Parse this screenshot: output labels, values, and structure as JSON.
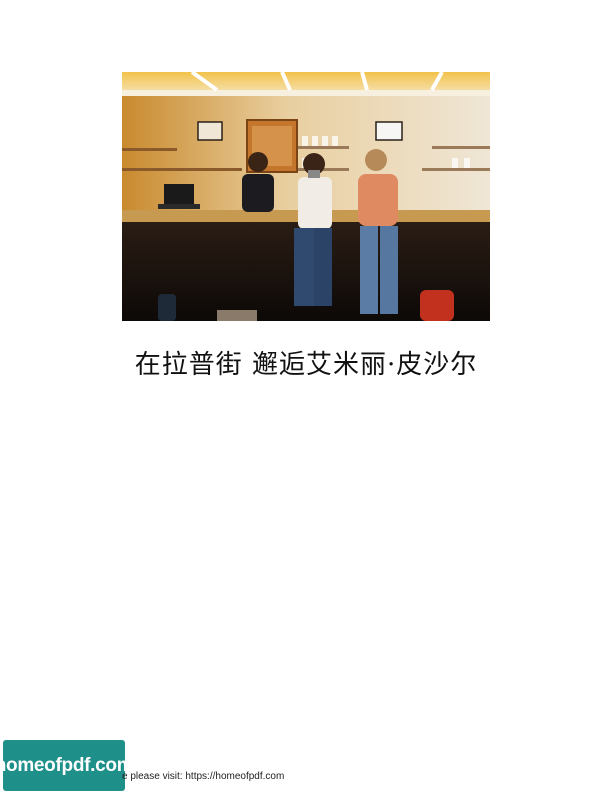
{
  "document": {
    "title": "在拉普街 邂逅艾米丽·皮沙尔",
    "cover_photo": {
      "description_icon": "cafe-photo"
    }
  },
  "footer": {
    "logo_text": "homeofpdf.com",
    "visit_text": "e please visit: https://homeofpdf.com"
  }
}
